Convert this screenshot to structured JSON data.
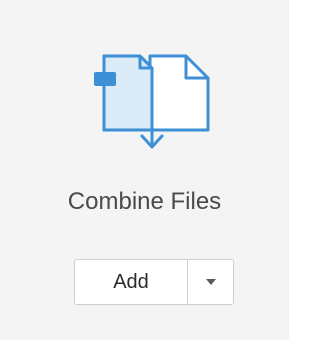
{
  "tool": {
    "title": "Combine Files",
    "icon": "combine-files-icon",
    "accent_color": "#3d8fd6",
    "icon_fill": "#dcebf8"
  },
  "split_button": {
    "label": "Add",
    "dropdown_icon": "chevron-down-icon"
  }
}
